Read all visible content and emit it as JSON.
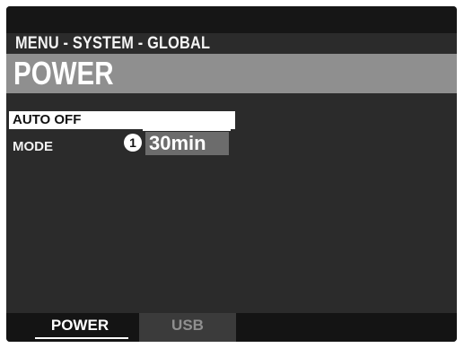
{
  "header": {
    "menu_path": "MENU - SYSTEM - GLOBAL",
    "title": "POWER"
  },
  "params": {
    "group_label": "AUTO OFF",
    "mode_label": "MODE",
    "badge": "1",
    "mode_value": "30min"
  },
  "tabs": [
    {
      "label": "POWER",
      "active": true
    },
    {
      "label": "USB",
      "active": false
    }
  ],
  "colors": {
    "screen_bg": "#2b2b2b",
    "title_bar": "#8f8f8f",
    "value_box": "#6c6c6c",
    "inactive_tab": "#3b3b3b"
  }
}
